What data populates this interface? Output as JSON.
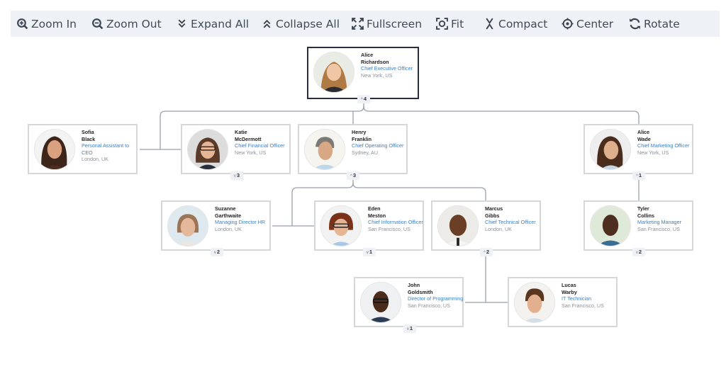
{
  "toolbar": {
    "items": [
      {
        "label": "Zoom In",
        "icon": "zoom-in-icon"
      },
      {
        "label": "Zoom Out",
        "icon": "zoom-out-icon"
      },
      {
        "label": "Expand All",
        "icon": "chevrons-down-icon"
      },
      {
        "label": "Collapse All",
        "icon": "chevrons-up-icon"
      },
      {
        "label": "Fullscreen",
        "icon": "fullscreen-icon"
      },
      {
        "label": "Fit",
        "icon": "fit-icon"
      },
      {
        "label": "Compact",
        "icon": "compact-icon"
      },
      {
        "label": "Center",
        "icon": "center-icon"
      },
      {
        "label": "Rotate",
        "icon": "rotate-icon"
      }
    ]
  },
  "colors": {
    "toolbar_bg": "#eef1f5",
    "title_blue": "#3a7fc1",
    "root_border": "#2a2e44",
    "node_border": "#d6d7d9",
    "link": "#9aa1ab"
  },
  "nodes": {
    "alice_richardson": {
      "first": "Alice",
      "last": "Richardson",
      "title": "Chief Executive Officer",
      "location": "New York, US",
      "children": "4",
      "expanded": true
    },
    "sofia_black": {
      "first": "Sofia",
      "last": "Black",
      "title": "Personal Assistant to CEO",
      "location": "London, UK"
    },
    "katie_mcdermott": {
      "first": "Katie",
      "last": "McDermott",
      "title": "Chief Financial Officer",
      "location": "New York, US",
      "children": "3",
      "expanded": false
    },
    "henry_franklin": {
      "first": "Henry",
      "last": "Franklin",
      "title": "Chief Operating Officer",
      "location": "Sydney, AU",
      "children": "3",
      "expanded": true
    },
    "alice_wade": {
      "first": "Alice",
      "last": "Wade",
      "title": "Chief Marketing Officer",
      "location": "New York, US",
      "children": "1",
      "expanded": true
    },
    "suzanne_garthwaite": {
      "first": "Suzanne",
      "last": "Garthwaite",
      "title": "Managing Director HR",
      "location": "London, UK",
      "children": "2",
      "expanded": false
    },
    "eden_meston": {
      "first": "Eden",
      "last": "Meston",
      "title": "Chief Information Officer",
      "location": "San Francisco, US",
      "children": "1",
      "expanded": false
    },
    "marcus_gibbs": {
      "first": "Marcus",
      "last": "Gibbs",
      "title": "Chief Technical Officer",
      "location": "London, UK",
      "children": "2",
      "expanded": true
    },
    "tyler_collins": {
      "first": "Tyler",
      "last": "Collins",
      "title": "Marketing Manager",
      "location": "San Francisco, US",
      "children": "2",
      "expanded": false
    },
    "john_goldsmith": {
      "first": "John",
      "last": "Goldsmith",
      "title": "Director of Programming",
      "location": "San Francisco, US",
      "children": "1",
      "expanded": false
    },
    "lucas_warby": {
      "first": "Lucas",
      "last": "Warby",
      "title": "IT Technician",
      "location": "San Francisco, US"
    }
  }
}
